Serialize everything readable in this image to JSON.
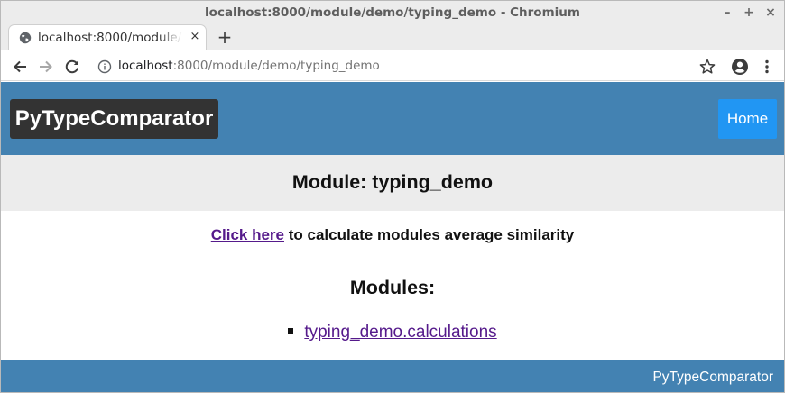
{
  "window": {
    "title": "localhost:8000/module/demo/typing_demo - Chromium",
    "controls": {
      "minimize": "–",
      "maximize": "+",
      "close": "×"
    }
  },
  "tab": {
    "title": "localhost:8000/module/demo/typing_demo",
    "close": "×"
  },
  "newtab": {
    "label": "+"
  },
  "address_bar": {
    "host": "localhost",
    "rest": ":8000/module/demo/typing_demo"
  },
  "site": {
    "brand": "PyTypeComparator",
    "home_label": "Home",
    "module_title": "Module: typing_demo",
    "calc_link": "Click here",
    "calc_text": " to calculate modules average similarity",
    "modules_heading": "Modules:",
    "modules": [
      "typing_demo.calculations"
    ],
    "footer": "PyTypeComparator"
  },
  "colors": {
    "header_bg": "#4382b2",
    "brand_bg": "#333333",
    "home_btn_bg": "#2196f3",
    "band_bg": "#ececec",
    "link": "#551a8b"
  },
  "icons": [
    "globe-icon",
    "back-arrow-icon",
    "forward-arrow-icon",
    "reload-icon",
    "info-icon",
    "star-icon",
    "account-icon",
    "kebab-menu-icon"
  ]
}
